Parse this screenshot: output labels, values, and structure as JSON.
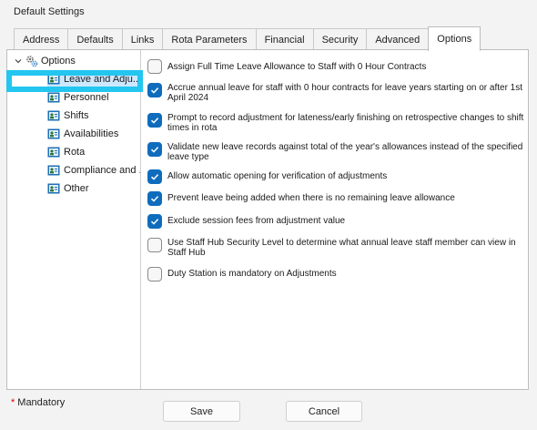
{
  "window": {
    "title": "Default Settings"
  },
  "tabs": [
    {
      "label": "Address"
    },
    {
      "label": "Defaults"
    },
    {
      "label": "Links"
    },
    {
      "label": "Rota Parameters"
    },
    {
      "label": "Financial"
    },
    {
      "label": "Security"
    },
    {
      "label": "Advanced"
    },
    {
      "label": "Options",
      "active": true
    }
  ],
  "tree": {
    "root_label": "Options",
    "items": [
      {
        "label": "Leave and Adju...",
        "selected": true
      },
      {
        "label": "Personnel"
      },
      {
        "label": "Shifts"
      },
      {
        "label": "Availabilities"
      },
      {
        "label": "Rota"
      },
      {
        "label": "Compliance and ..."
      },
      {
        "label": "Other"
      }
    ]
  },
  "options": [
    {
      "label": "Assign Full Time Leave Allowance to Staff with 0 Hour Contracts",
      "checked": false
    },
    {
      "label": "Accrue annual leave for staff with 0 hour contracts for leave years starting on or after 1st April 2024",
      "checked": true
    },
    {
      "label": "Prompt to record adjustment for lateness/early finishing on retrospective changes to shift times in rota",
      "checked": true
    },
    {
      "label": "Validate new leave records against total of the year's allowances instead of the specified leave type",
      "checked": true
    },
    {
      "label": "Allow automatic opening for verification of adjustments",
      "checked": true
    },
    {
      "label": "Prevent leave being added when there is no remaining leave allowance",
      "checked": true
    },
    {
      "label": "Exclude session fees from adjustment value",
      "checked": true
    },
    {
      "label": "Use Staff Hub Security Level to determine what annual leave staff member can view in Staff Hub",
      "checked": false
    },
    {
      "label": "Duty Station is mandatory on Adjustments",
      "checked": false
    }
  ],
  "footer": {
    "mandatory_label": "Mandatory",
    "mandatory_marker": "*",
    "save_label": "Save",
    "cancel_label": "Cancel"
  },
  "colors": {
    "checkbox_checked": "#0f6cbd",
    "selection_highlight": "#22c6ef",
    "mandatory_star": "#d40000"
  },
  "icons": {
    "tree_root": "settings-gears-icon",
    "tree_item": "user-card-icon",
    "expand": "chevron-down-icon",
    "check": "checkmark-icon"
  }
}
